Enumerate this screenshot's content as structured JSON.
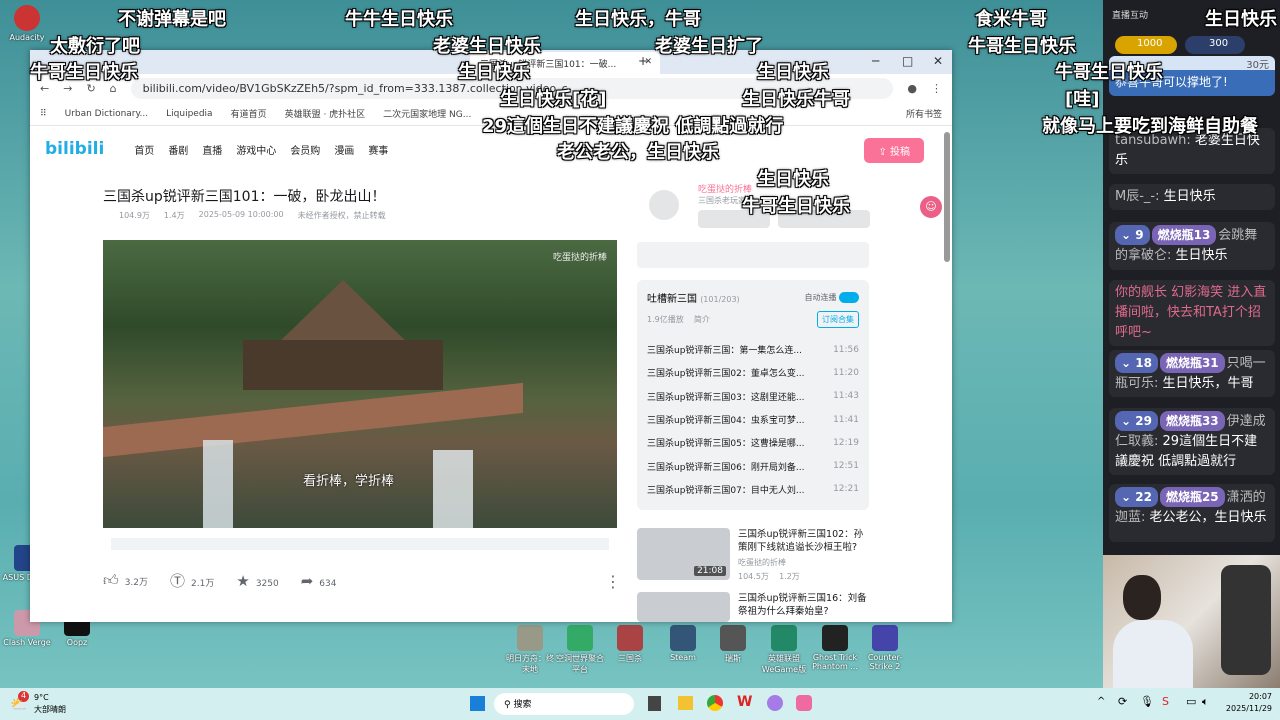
{
  "desktop": {
    "icons_left": [
      "Audacity",
      "Clash Verge",
      "Oopz",
      "ASUS Driver"
    ],
    "icons_bottom": [
      "明日方舟：终末地",
      "空洞世界聚合平台",
      "三国杀",
      "Steam",
      "瑞斯",
      "英雄联盟WeGame版",
      "Ghost Trick Phantom ...",
      "Counter-Strike 2"
    ]
  },
  "browser": {
    "tab_title": "三国杀up锐评新三国101：一破...",
    "url": "bilibili.com/video/BV1GbSKzZEh5/?spm_id_from=333.1387.collection.video_c",
    "bookmarks": [
      "Urban Dictionary...",
      "Liquipedia",
      "有道首页",
      "英雄联盟 · 虎扑社区",
      "二次元国家地理 NG..."
    ],
    "all_bookmarks": "所有书签"
  },
  "site": {
    "logo": "bilibili",
    "nav": [
      "首页",
      "番剧",
      "直播",
      "游戏中心",
      "会员购",
      "漫画",
      "赛事"
    ],
    "upload": "投稿"
  },
  "video": {
    "title": "三国杀up锐评新三国101：一破，卧龙出山！",
    "views": "104.9万",
    "danmaku": "1.4万",
    "date": "2025-05-09 10:00:00",
    "notice": "未经作者授权，禁止转载",
    "subtitle": "看折棒，学折棒",
    "watermark": "吃蛋挞的折棒",
    "likes": "3.2万",
    "coins": "2.1万",
    "favorites": "3250",
    "shares": "634"
  },
  "uploader": {
    "name": "吃蛋挞的折棒",
    "desc": "三国杀老玩家"
  },
  "playlist": {
    "title": "吐槽新三国",
    "progress": "(101/203)",
    "plays": "1.9亿播放",
    "intro": "简介",
    "autoplay": "自动连播",
    "subscribe": "订阅合集",
    "items": [
      {
        "t": "三国杀up锐评新三国：第一集怎么连...",
        "d": "11:56"
      },
      {
        "t": "三国杀up锐评新三国02：董卓怎么变...",
        "d": "11:20"
      },
      {
        "t": "三国杀up锐评新三国03：这剧里还能...",
        "d": "11:43"
      },
      {
        "t": "三国杀up锐评新三国04：虫系宝可梦...",
        "d": "11:41"
      },
      {
        "t": "三国杀up锐评新三国05：这曹操是哪...",
        "d": "12:19"
      },
      {
        "t": "三国杀up锐评新三国06：刚开局刘备...",
        "d": "12:51"
      },
      {
        "t": "三国杀up锐评新三国07：目中无人刘...",
        "d": "12:21"
      }
    ]
  },
  "recommend": [
    {
      "title": "三国杀up锐评新三国102：孙策刚下线就追谥长沙桓王啦?",
      "author": "吃蛋挞的折棒",
      "views": "104.5万",
      "dm": "1.2万",
      "duration": "21:08"
    },
    {
      "title": "三国杀up锐评新三国16：刘备祭祖为什么拜秦始皇?"
    }
  ],
  "chat": {
    "header": "直播互动",
    "ranks": [
      "1000",
      "300"
    ],
    "sc_price": "30元",
    "sc_text": "恭喜牛哥可以撑地了!",
    "messages": [
      {
        "user": "tansubawh",
        "text": "老婆生日快乐"
      },
      {
        "user": "M辰-_-",
        "text": "生日快乐"
      },
      {
        "lv": "9",
        "fan": "燃烧瓶13",
        "user": "会跳舞的拿破仑",
        "text": "生日快乐"
      },
      {
        "system": "你的舰长 幻影海笑 进入直播间啦，快去和TA打个招呼吧~"
      },
      {
        "lv": "18",
        "fan": "燃烧瓶31",
        "user": "只喝一瓶可乐",
        "text": "生日快乐，牛哥"
      },
      {
        "lv": "29",
        "fan": "燃烧瓶33",
        "user": "伊達成仁取義",
        "text": "29這個生日不建議慶祝 低調點過就行"
      },
      {
        "lv": "22",
        "fan": "燃烧瓶25",
        "user": "潇洒的迦蓝",
        "text": "老公老公，生日快乐"
      }
    ]
  },
  "danmaku": [
    "不谢弹幕是吧",
    "牛牛生日快乐",
    "生日快乐，牛哥",
    "食米牛哥",
    "生日快乐",
    "太敷衍了吧",
    "老婆生日快乐",
    "老婆生日扩了",
    "牛哥生日快乐",
    "牛哥生日快乐",
    "生日快乐",
    "生日快乐",
    "牛哥生日快乐",
    "生日快乐[花]",
    "生日快乐牛哥",
    "[哇]",
    "29這個生日不建議慶祝 低調點過就行",
    "就像马上要吃到海鲜自助餐",
    "老公老公，生日快乐",
    "生日快乐",
    "牛哥生日快乐"
  ],
  "taskbar": {
    "temp": "9°C",
    "weather": "大部晴朗",
    "weather_badge": "4",
    "search": "搜索",
    "time": "20:07",
    "date": "2025/11/29"
  }
}
